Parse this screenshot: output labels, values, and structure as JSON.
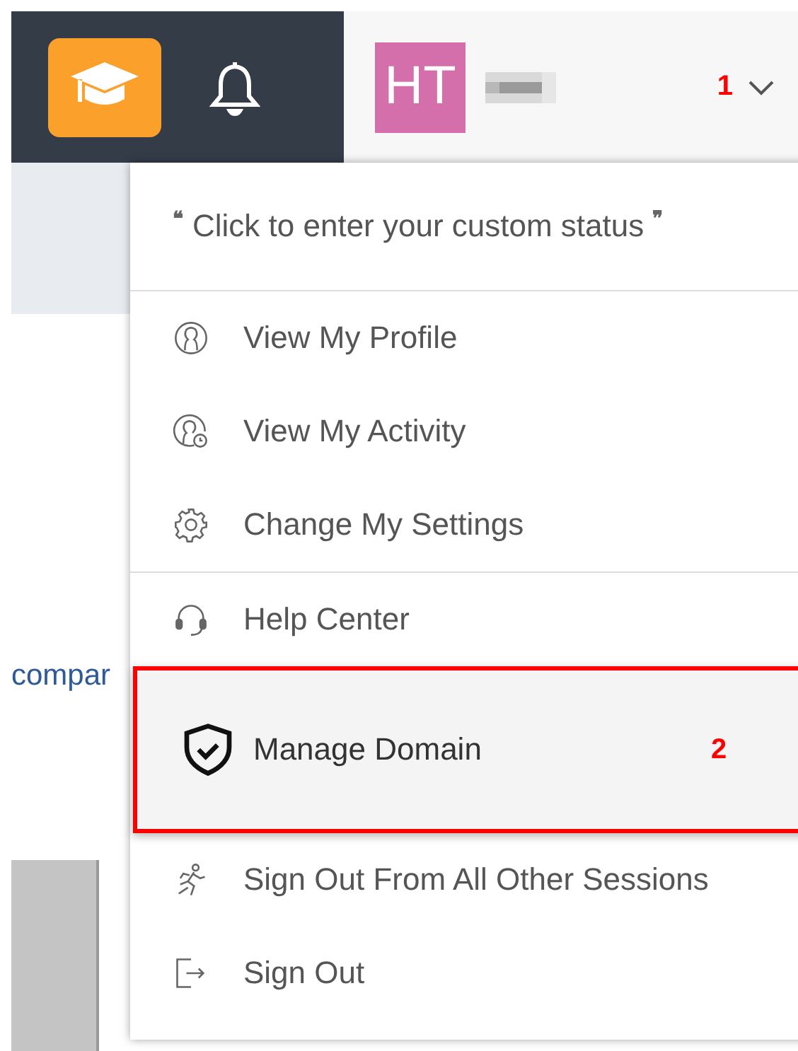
{
  "header": {
    "avatar_initials": "HT",
    "annotation": "1"
  },
  "background": {
    "snippet": "compar"
  },
  "menu": {
    "status": {
      "open_quote": "❝",
      "text": "Click to enter your custom status",
      "close_quote": "❞"
    },
    "groups": [
      {
        "items": [
          {
            "label": "View My Profile",
            "selected": false
          },
          {
            "label": "View My Activity",
            "selected": false
          },
          {
            "label": "Change My Settings",
            "selected": false
          }
        ]
      },
      {
        "items": [
          {
            "label": "Help Center",
            "selected": false
          },
          {
            "label": "Manage Domain",
            "selected": true,
            "annotation": "2"
          },
          {
            "label": "Sign Out From All Other Sessions",
            "selected": false
          },
          {
            "label": "Sign Out",
            "selected": false
          }
        ]
      }
    ]
  }
}
